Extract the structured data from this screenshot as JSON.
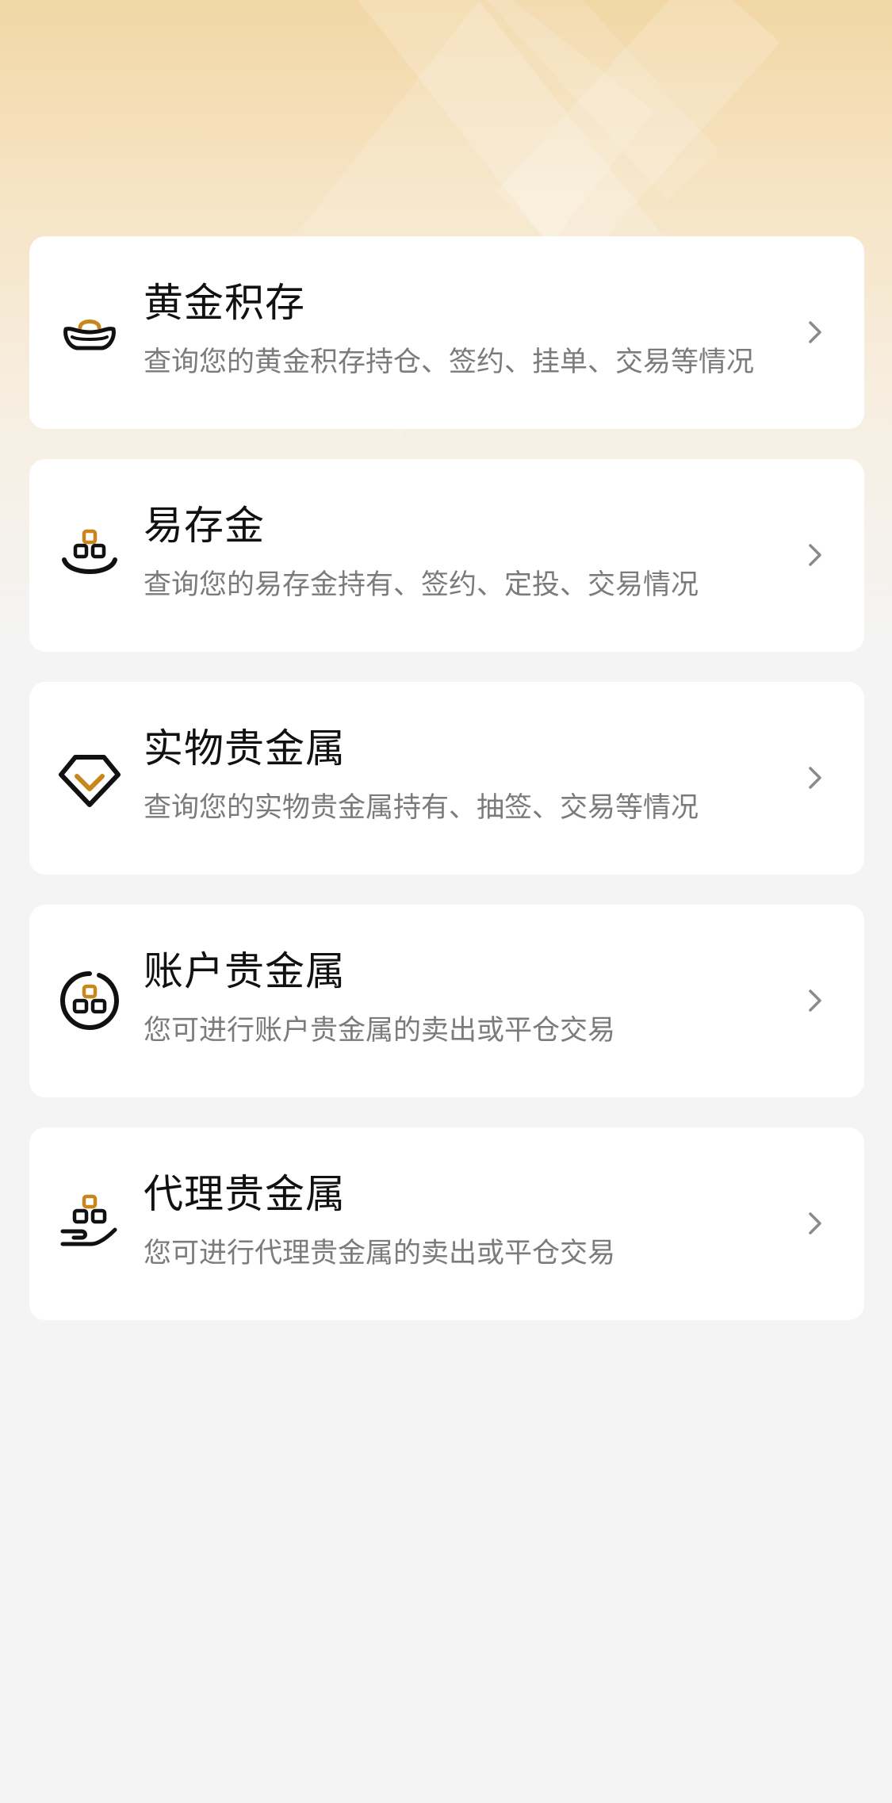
{
  "colors": {
    "gold": "#c9861c",
    "icon_dark": "#111111",
    "title": "#111111",
    "desc": "#7b7b7b",
    "chevron": "#8a8a8a"
  },
  "services": [
    {
      "icon": "gold-ingot-icon",
      "title": "黄金积存",
      "desc": "查询您的黄金积存持仓、签约、挂单、交易等情况"
    },
    {
      "icon": "gold-bars-stack-icon",
      "title": "易存金",
      "desc": "查询您的易存金持有、签约、定投、交易情况"
    },
    {
      "icon": "diamond-icon",
      "title": "实物贵金属",
      "desc": "查询您的实物贵金属持有、抽签、交易等情况"
    },
    {
      "icon": "account-gold-bars-icon",
      "title": "账户贵金属",
      "desc": "您可进行账户贵金属的卖出或平仓交易"
    },
    {
      "icon": "hand-gold-bars-icon",
      "title": "代理贵金属",
      "desc": "您可进行代理贵金属的卖出或平仓交易"
    }
  ]
}
